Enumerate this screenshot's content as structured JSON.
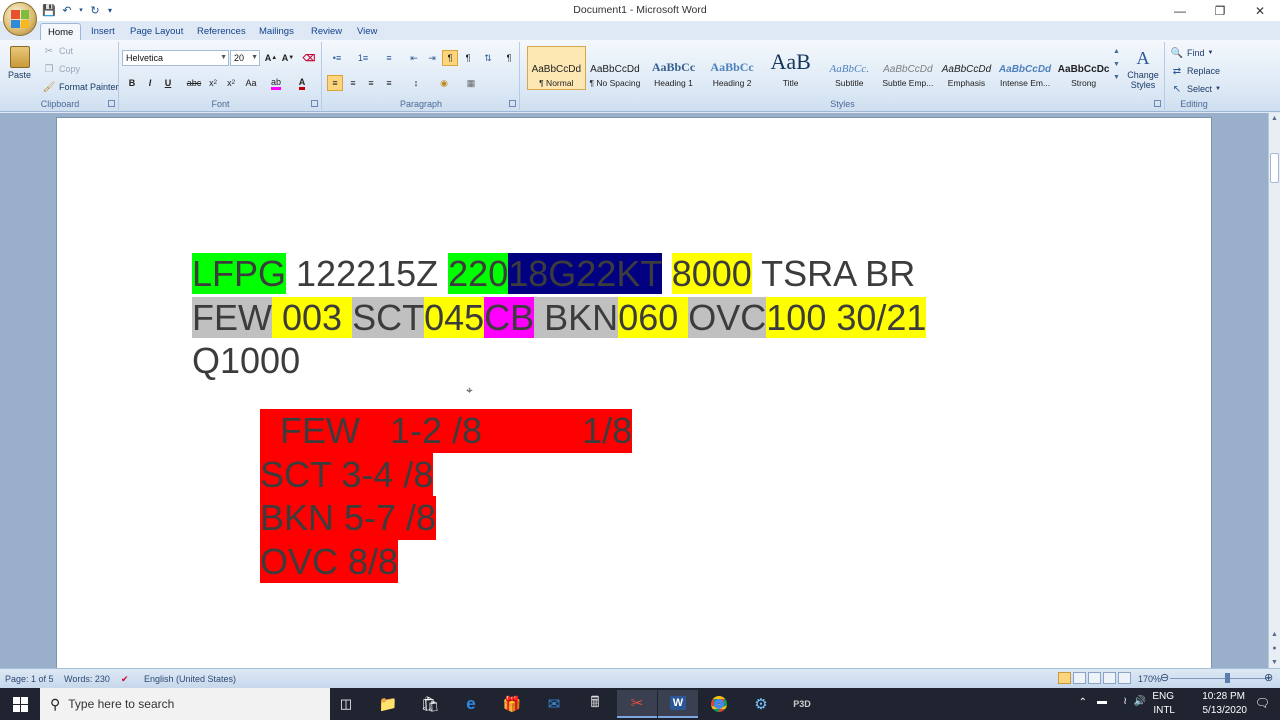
{
  "window": {
    "title": "Document1 - Microsoft Word",
    "controls": [
      "minimize-icon",
      "restore-icon",
      "close-icon"
    ]
  },
  "tabs": [
    "Home",
    "Insert",
    "Page Layout",
    "References",
    "Mailings",
    "Review",
    "View"
  ],
  "ribbon": {
    "clipboard": {
      "paste": "Paste",
      "cut": "Cut",
      "copy": "Copy",
      "format_painter": "Format Painter",
      "label": "Clipboard"
    },
    "font": {
      "name": "Helvetica",
      "size": "20",
      "label": "Font"
    },
    "paragraph": {
      "label": "Paragraph"
    },
    "styles": {
      "label": "Styles",
      "items": [
        {
          "preview": "AaBbCcDd",
          "name": "¶ Normal"
        },
        {
          "preview": "AaBbCcDd",
          "name": "¶ No Spacing"
        },
        {
          "preview": "AaBbCc",
          "name": "Heading 1"
        },
        {
          "preview": "AaBbCc",
          "name": "Heading 2"
        },
        {
          "preview": "AaB",
          "name": "Title"
        },
        {
          "preview": "AaBbCc.",
          "name": "Subtitle"
        },
        {
          "preview": "AaBbCcDd",
          "name": "Subtle Emp..."
        },
        {
          "preview": "AaBbCcDd",
          "name": "Emphasis"
        },
        {
          "preview": "AaBbCcDd",
          "name": "Intense Em..."
        },
        {
          "preview": "AaBbCcDc",
          "name": "Strong"
        }
      ],
      "change_styles": "Change Styles"
    },
    "editing": {
      "find": "Find",
      "replace": "Replace",
      "select": "Select",
      "label": "Editing"
    }
  },
  "document": {
    "metar_lines": [
      [
        {
          "text": "LFPG",
          "bg": "#00ff00",
          "fg": "#3c3c3c"
        },
        {
          "text": " 122215Z ",
          "bg": "transparent",
          "fg": "#3c3c3c"
        },
        {
          "text": "220",
          "bg": "#00ff00",
          "fg": "#3c3c3c"
        },
        {
          "text": "18G22KT",
          "bg": "#000080",
          "fg": "#3c3c3c"
        },
        {
          "text": " ",
          "bg": "transparent",
          "fg": "#3c3c3c"
        },
        {
          "text": "8000",
          "bg": "#ffff00",
          "fg": "#3c3c3c"
        },
        {
          "text": " TSRA BR",
          "bg": "transparent",
          "fg": "#3c3c3c"
        }
      ],
      [
        {
          "text": "FEW",
          "bg": "#c0c0c0",
          "fg": "#3c3c3c"
        },
        {
          "text": " 003 ",
          "bg": "#ffff00",
          "fg": "#3c3c3c"
        },
        {
          "text": "SCT",
          "bg": "#c0c0c0",
          "fg": "#3c3c3c"
        },
        {
          "text": "045",
          "bg": "#ffff00",
          "fg": "#3c3c3c"
        },
        {
          "text": "CB",
          "bg": "#ff00ff",
          "fg": "#3c3c3c"
        },
        {
          "text": " BKN",
          "bg": "#c0c0c0",
          "fg": "#3c3c3c"
        },
        {
          "text": "060 ",
          "bg": "#ffff00",
          "fg": "#3c3c3c"
        },
        {
          "text": "OVC",
          "bg": "#c0c0c0",
          "fg": "#3c3c3c"
        },
        {
          "text": "100 30/21",
          "bg": "#ffff00",
          "fg": "#3c3c3c"
        }
      ],
      [
        {
          "text": "Q1000",
          "bg": "transparent",
          "fg": "#3c3c3c"
        }
      ]
    ],
    "cloud_lines": [
      "  FEW   1-2 /8          1/8",
      "SCT 3-4 /8",
      "BKN 5-7 /8",
      "OVC 8/8"
    ],
    "cloud_bg": "#ff0000"
  },
  "status": {
    "page": "Page: 1 of 5",
    "words": "Words: 230",
    "language": "English (United States)",
    "zoom": "170%"
  },
  "taskbar": {
    "search_placeholder": "Type here to search",
    "lang1": "ENG",
    "lang2": "INTL",
    "time": "10:28 PM",
    "date": "5/13/2020",
    "apps": [
      "task-view-icon",
      "file-explorer-icon",
      "store-icon",
      "edge-icon",
      "gift-icon",
      "mail-icon",
      "calculator-icon",
      "snipping-icon",
      "word-icon",
      "chrome-icon",
      "vs-icon",
      "p3d-icon"
    ]
  }
}
